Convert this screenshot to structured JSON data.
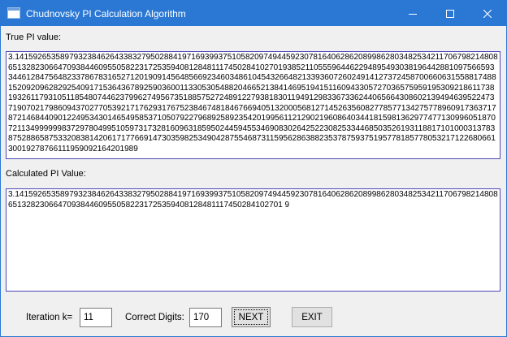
{
  "window": {
    "title": "Chudnovsky PI Calculation Algorithm",
    "accent_color": "#2b78d4",
    "icons": [
      "app-icon",
      "minimize-icon",
      "maximize-icon",
      "close-icon"
    ]
  },
  "true_pi": {
    "label": "True PI value:",
    "value": "3.1415926535897932384626433832795028841971693993751058209749445923078164062862089986280348253421170679821480865132823066470938446095505822317253594081284811174502841027019385211055596446229489549303819644288109756659334461284756482337867831652712019091456485669234603486104543266482133936072602491412737245870066063155881748815209209628292540917153643678925903600113305305488204665213841469519415116094330572703657595919530921861173819326117931051185480744623799627495673518857527248912279381830119491298336733624406566430860213949463952247371907021798609437027705392171762931767523846748184676694051320005681271452635608277857713427577896091736371787214684409012249534301465495853710507922796892589235420199561121290219608640344181598136297747713099605187072113499999983729780499510597317328160963185950244594553469083026425223082533446850352619311881710100031378387528865875332083814206171776691473035982534904287554687311595628638823537875937519577818577805321712268066130019278766111959092164201989"
  },
  "calculated_pi": {
    "label": "Calculated PI Value:",
    "value": "3.141592653589793238462643383279502884197169399375105820974944592307816406286208998628034825342117067982148086513282306647093844609550582231725359408128481117450284102701 9"
  },
  "controls": {
    "iteration_label": "Iteration k=",
    "iteration_value": "11",
    "digits_label": "Correct Digits:",
    "digits_value": "170",
    "next_label": "NEXT",
    "exit_label": "EXIT"
  }
}
